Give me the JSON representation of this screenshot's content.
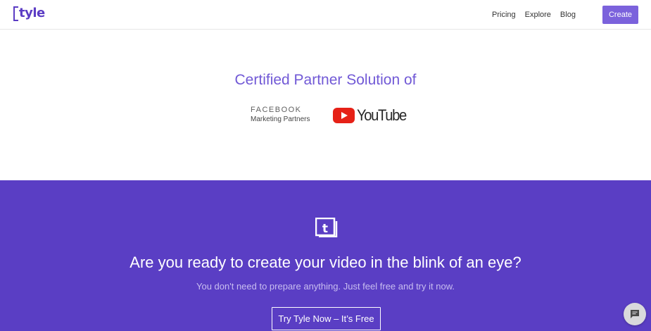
{
  "header": {
    "logo_text": "tyle",
    "nav": [
      "Pricing",
      "Explore",
      "Blog"
    ],
    "create_label": "Create"
  },
  "partners": {
    "title": "Certified Partner Solution of",
    "facebook_name": "FACEBOOK",
    "facebook_sub": "Marketing Partners",
    "youtube_word": "YouTube"
  },
  "cta": {
    "heading": "Are you ready to create your video in the blink of an eye?",
    "subtext": "You don't need to prepare anything. Just feel free and try it now.",
    "button_label": "Try Tyle Now – It’s Free"
  },
  "icons": {
    "cta_logo": "tyle-logo-icon",
    "chat": "chat-bubble-icon"
  },
  "colors": {
    "brand_purple": "#5a3ec4",
    "accent_purple": "#7b62dc",
    "title_purple": "#7159d6",
    "youtube_red": "#e62117"
  }
}
